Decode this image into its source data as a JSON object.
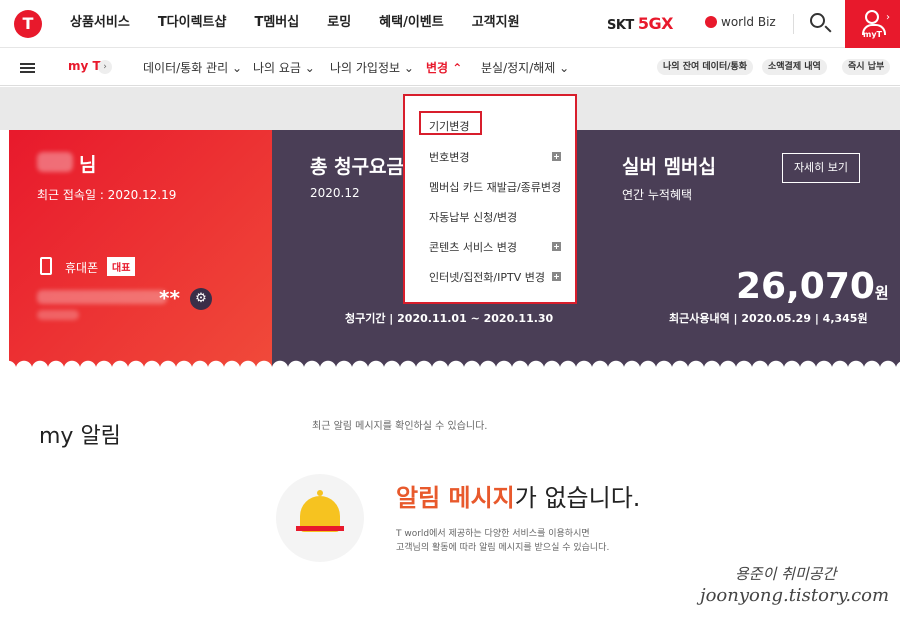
{
  "header": {
    "gnb": [
      "상품서비스",
      "T다이렉트샵",
      "T멤버십",
      "로밍",
      "혜택/이벤트",
      "고객지원"
    ],
    "skt_label": "SKT",
    "fiveg_label": "5GX",
    "worldbiz": "world Biz",
    "myt_label": "myT"
  },
  "subnav": {
    "myt": "my T",
    "items": [
      "데이터/통화 관리",
      "나의 요금",
      "나의 가입정보",
      "변경",
      "분실/정지/해제"
    ],
    "quick": [
      "나의 잔여 데이터/통화",
      "소액결제 내역",
      "즉시 납부"
    ]
  },
  "user": {
    "suffix": "님",
    "last_login": "최근 접속일 : 2020.12.19",
    "phone_label": "휴대폰",
    "badge": "대표",
    "masked": "**"
  },
  "bill": {
    "title": "총 청구요금",
    "month": "2020.12",
    "period": "청구기간 | 2020.11.01 ~ 2020.11.30"
  },
  "membership": {
    "title": "실버 멤버십",
    "sub": "연간 누적혜택",
    "detail_btn": "자세히 보기",
    "amount": "26,070",
    "unit": "원",
    "recent": "최근사용내역 | 2020.05.29 | 4,345원"
  },
  "dropdown": {
    "items": [
      "기기변경",
      "번호변경",
      "멤버십 카드 재발급/종류변경",
      "자동납부 신청/변경",
      "콘텐츠 서비스 변경",
      "인터넷/집전화/IPTV 변경"
    ]
  },
  "alarm": {
    "title": "my 알림",
    "desc": "최근 알림 메시지를 확인하실 수 있습니다.",
    "empty_red": "알림 메시지",
    "empty_rest": "가 없습니다.",
    "empty_sub1": "T world에서 제공하는 다양한 서비스를 이용하시면",
    "empty_sub2": "고객님의 활동에 따라 알림 메시지를 받으실 수 있습니다."
  },
  "watermark": {
    "line1": "용준이 취미공간",
    "line2": "joonyong.tistory.com"
  }
}
